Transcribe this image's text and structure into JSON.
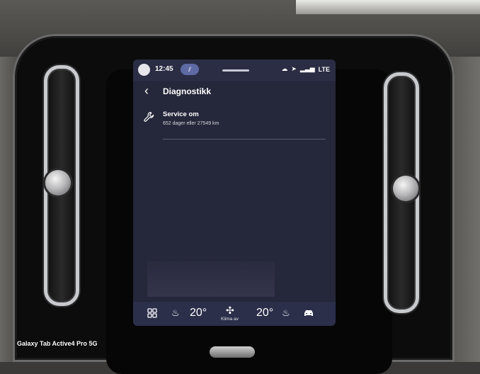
{
  "status_bar": {
    "time": "12:45",
    "pill_label": "",
    "network": "LTE"
  },
  "header": {
    "title": "Diagnostikk",
    "back_icon": "chevron-left-icon"
  },
  "service": {
    "title": "Service om",
    "subtitle": "652 dager eller 27549 km",
    "icon": "wrench-icon"
  },
  "bottom_bar": {
    "temp_left": "20°",
    "temp_right": "20°",
    "climate_label": "Klima av",
    "icons": [
      "grid-icon",
      "heated-seat-icon",
      "fan-icon",
      "heated-seat-icon",
      "car-icon"
    ]
  },
  "device_caption": "Galaxy Tab Active4 Pro 5G",
  "colors": {
    "screen_bg": "#25273a",
    "bar_bg": "#2b2f4a",
    "accent": "#5e6aa3"
  }
}
